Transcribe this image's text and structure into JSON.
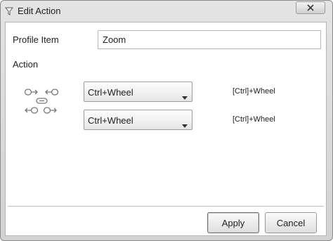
{
  "window": {
    "title": "Edit Action",
    "title_icon": "funnel-icon",
    "close_icon": "close-x-icon"
  },
  "form": {
    "profile_item_label": "Profile Item",
    "profile_item_value": "Zoom",
    "action_label": "Action"
  },
  "actions": [
    {
      "selected": "Ctrl+Wheel",
      "shortcut": "[Ctrl]+Wheel"
    },
    {
      "selected": "Ctrl+Wheel",
      "shortcut": "[Ctrl]+Wheel"
    }
  ],
  "action_icon": "mouse-wheel-direction-icon",
  "buttons": {
    "apply": "Apply",
    "cancel": "Cancel"
  },
  "colors": {
    "window_frame": "#d8d8d8",
    "client_background": "#ffffff",
    "icon_gray": "#777777"
  }
}
